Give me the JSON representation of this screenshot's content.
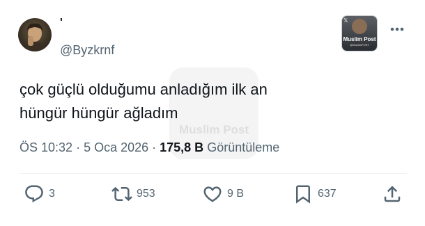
{
  "author": {
    "display_name": "'",
    "handle": "@Byzkrnf"
  },
  "watermark_logo": {
    "title": "Muslim Post",
    "handle": "@MuslimPOST"
  },
  "tweet": {
    "lines": [
      "çok güçlü olduğumu anladığım ilk an",
      "hüngür hüngür ağladım"
    ]
  },
  "watermark": {
    "text": "Muslim Post"
  },
  "meta": {
    "time": "ÖS 10:32",
    "sep1": " · ",
    "date": "5 Oca 2026",
    "sep2": " · ",
    "views_count": "175,8 B",
    "views_label": " Görüntüleme"
  },
  "actions": {
    "replies": "3",
    "reposts": "953",
    "likes": "9 B",
    "bookmarks": "637"
  },
  "icons": {
    "more": "more-horizontal-icon",
    "reply": "reply-icon",
    "repost": "repost-icon",
    "like": "heart-icon",
    "bookmark": "bookmark-icon",
    "share": "share-icon"
  },
  "colors": {
    "text_primary": "#0f1419",
    "text_secondary": "#536471",
    "divider": "#eff3f4"
  }
}
